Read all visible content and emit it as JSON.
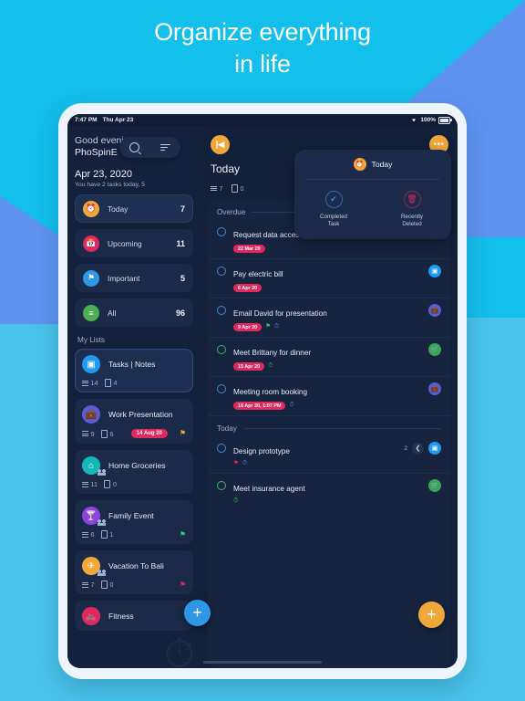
{
  "headline": {
    "line1": "Organize everything",
    "line2": "in life"
  },
  "statusbar": {
    "time": "7:47 PM",
    "date": "Thu Apr 23",
    "battery": "100%",
    "wifi_icon": "wifi-icon"
  },
  "sidebar": {
    "greeting_line1": "Good evening",
    "greeting_line2": "PhoSpinE",
    "date": "Apr 23, 2020",
    "subtitle": "You have 2 tasks today, 5",
    "search": {
      "search_icon": "search-icon",
      "sort_icon": "sort-icon"
    },
    "smart_lists": [
      {
        "label": "Today",
        "count": "7",
        "icon": "alarm-clock-icon",
        "color": "#f2a73b",
        "glyph": "⏰"
      },
      {
        "label": "Upcoming",
        "count": "11",
        "icon": "calendar-icon",
        "color": "#e2295f",
        "glyph": "📅"
      },
      {
        "label": "Important",
        "count": "5",
        "icon": "flag-icon",
        "color": "#2e97e6",
        "glyph": "⚑"
      },
      {
        "label": "All",
        "count": "96",
        "icon": "list-icon",
        "color": "#4caf50",
        "glyph": "≡"
      }
    ],
    "my_lists_title": "My Lists",
    "lists": [
      {
        "name": "Tasks | Notes",
        "tasks": "14",
        "notes": "4",
        "icon": "monitor-icon",
        "color": "#1e9bf0",
        "glyph": "▣",
        "shared": false,
        "selected": true,
        "chip": "",
        "flag": ""
      },
      {
        "name": "Work Presentation",
        "tasks": "9",
        "notes": "6",
        "icon": "briefcase-icon",
        "color": "#5b5bd6",
        "glyph": "💼",
        "shared": false,
        "selected": false,
        "chip": "14 Aug 20",
        "flag": "#f2a73b"
      },
      {
        "name": "Home Groceries",
        "tasks": "11",
        "notes": "0",
        "icon": "home-icon",
        "color": "#14b8b8",
        "glyph": "⌂",
        "shared": true,
        "selected": false,
        "chip": "",
        "flag": ""
      },
      {
        "name": "Family Event",
        "tasks": "6",
        "notes": "1",
        "icon": "cocktail-icon",
        "color": "#8e44e0",
        "glyph": "🍸",
        "shared": true,
        "selected": false,
        "chip": "",
        "flag": "#2ecc71"
      },
      {
        "name": "Vacation To Bali",
        "tasks": "7",
        "notes": "0",
        "icon": "airplane-icon",
        "color": "#f2a73b",
        "glyph": "✈",
        "shared": true,
        "selected": false,
        "chip": "",
        "flag": "#e2295f"
      },
      {
        "name": "Fitness",
        "tasks": "",
        "notes": "",
        "icon": "bicycle-icon",
        "color": "#e2295f",
        "glyph": "🚲",
        "shared": false,
        "selected": false,
        "chip": "",
        "flag": ""
      }
    ],
    "add_button": "+"
  },
  "main": {
    "collapse_icon": "collapse-panel-icon",
    "collapse_glyph": "|◀",
    "more_icon": "more-options-icon",
    "more_glyph": "•••",
    "title": "Today",
    "tasks_count": "7",
    "notes_count": "0",
    "add_button": "+",
    "sections": [
      {
        "label": "Overdue",
        "tasks": [
          {
            "title": "Request data access permission",
            "date": "22 Mar 20",
            "circle": "blue",
            "alarm": false,
            "flag": "",
            "subtasks": "",
            "type_icon": "briefcase-icon",
            "type_color": "#5b5bd6",
            "type_glyph": "💼"
          },
          {
            "title": "Pay electric bill",
            "date": "6 Apr 20",
            "circle": "blue",
            "alarm": false,
            "flag": "",
            "subtasks": "",
            "type_icon": "monitor-icon",
            "type_color": "#1e9bf0",
            "type_glyph": "▣"
          },
          {
            "title": "Email David for presentation",
            "date": "9 Apr 20",
            "circle": "blue",
            "alarm": true,
            "flag": "#2ecc71",
            "subtasks": "",
            "type_icon": "briefcase-icon",
            "type_color": "#5b5bd6",
            "type_glyph": "💼"
          },
          {
            "title": "Meet Brittany for dinner",
            "date": "15 Apr 20",
            "circle": "green",
            "alarm": true,
            "flag": "",
            "subtasks": "",
            "type_icon": "groceries-icon",
            "type_color": "#3aa655",
            "type_glyph": "🛒"
          },
          {
            "title": "Meeting room booking",
            "date": "16 Apr 20, 1:07 PM",
            "circle": "blue",
            "alarm": true,
            "flag": "",
            "subtasks": "",
            "type_icon": "briefcase-icon",
            "type_color": "#5b5bd6",
            "type_glyph": "💼"
          }
        ]
      },
      {
        "label": "Today",
        "tasks": [
          {
            "title": "Design prototype",
            "date": "",
            "circle": "blue",
            "alarm": true,
            "flag": "#e2295f",
            "subtasks": "2",
            "type_icon": "monitor-icon",
            "type_color": "#1e9bf0",
            "type_glyph": "▣"
          },
          {
            "title": "Meet insurance agent",
            "date": "",
            "circle": "green",
            "alarm": true,
            "flag": "",
            "subtasks": "",
            "type_icon": "groceries-icon",
            "type_color": "#3aa655",
            "type_glyph": "🛒"
          }
        ]
      }
    ]
  },
  "popup": {
    "icon": "alarm-clock-icon",
    "icon_glyph": "⏰",
    "title": "Today",
    "actions": [
      {
        "label": "Completed\nTask",
        "label_l1": "Completed",
        "label_l2": "Task",
        "icon": "check-circle-icon",
        "glyph": "✔",
        "style": "blue"
      },
      {
        "label": "Recently\nDeleted",
        "label_l1": "Recently",
        "label_l2": "Deleted",
        "icon": "trash-icon",
        "glyph": "🗑",
        "style": "pink"
      }
    ]
  },
  "colors": {
    "accent_orange": "#f2a73b",
    "accent_blue": "#2e97e6",
    "accent_pink": "#e2295f",
    "bg_cyan": "#13bfeb",
    "bg_blue": "#5f93f2",
    "screen_bg": "#13203a"
  }
}
